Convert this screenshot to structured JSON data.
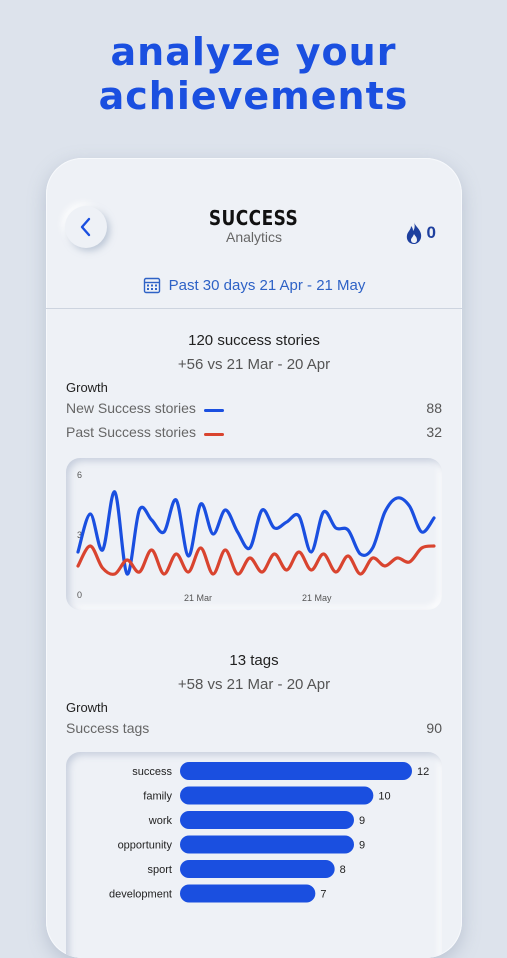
{
  "headline": {
    "line1": "analyze your",
    "line2": "achievements"
  },
  "nav": {
    "title": "SUCCESS",
    "subtitle": "Analytics",
    "streak_count": "0"
  },
  "date_range": "Past 30 days 21 Apr - 21 May",
  "stories": {
    "title": "120 success stories",
    "comparison": "+56 vs 21 Mar - 20 Apr",
    "growth_label": "Growth",
    "legend": [
      {
        "label": "New Success stories",
        "value": "88",
        "color": "#1a4fe0"
      },
      {
        "label": "Past Success stories",
        "value": "32",
        "color": "#d9442f"
      }
    ]
  },
  "tags": {
    "title": "13 tags",
    "comparison": "+58 vs 21 Mar - 20 Apr",
    "growth_label": "Growth",
    "summary_label": "Success tags",
    "summary_value": "90"
  },
  "chart_data": [
    {
      "type": "line",
      "yticks": [
        "6",
        "3",
        "0"
      ],
      "ylim": [
        0,
        6
      ],
      "xticks": [
        "21 Mar",
        "21 May"
      ],
      "series": [
        {
          "name": "New Success stories",
          "color": "#1a4fe0",
          "values": [
            2.3,
            4.2,
            2.4,
            5.3,
            1.2,
            4.4,
            3.9,
            3.3,
            4.9,
            2.1,
            4.7,
            3.2,
            4.4,
            3.3,
            2.5,
            4.4,
            3.5,
            3.8,
            4.1,
            2.3,
            4.3,
            3.5,
            3.4,
            2.2,
            2.5,
            4.3,
            5.0,
            4.6,
            3.3,
            4.0
          ]
        },
        {
          "name": "Past Success stories",
          "color": "#d9442f",
          "values": [
            1.6,
            2.6,
            1.5,
            1.2,
            1.9,
            1.3,
            2.4,
            1.2,
            2.2,
            1.3,
            2.5,
            1.2,
            2.4,
            1.2,
            2.0,
            1.3,
            2.2,
            1.4,
            2.3,
            1.4,
            2.2,
            1.3,
            2.1,
            1.2,
            2.0,
            1.6,
            2.0,
            1.8,
            2.5,
            2.6
          ]
        }
      ]
    },
    {
      "type": "bar",
      "orientation": "horizontal",
      "categories": [
        "success",
        "family",
        "work",
        "opportunity",
        "sport",
        "development"
      ],
      "values": [
        12,
        10,
        9,
        9,
        8,
        7
      ],
      "xlim": [
        0,
        12
      ],
      "color": "#1a4fe0"
    }
  ]
}
